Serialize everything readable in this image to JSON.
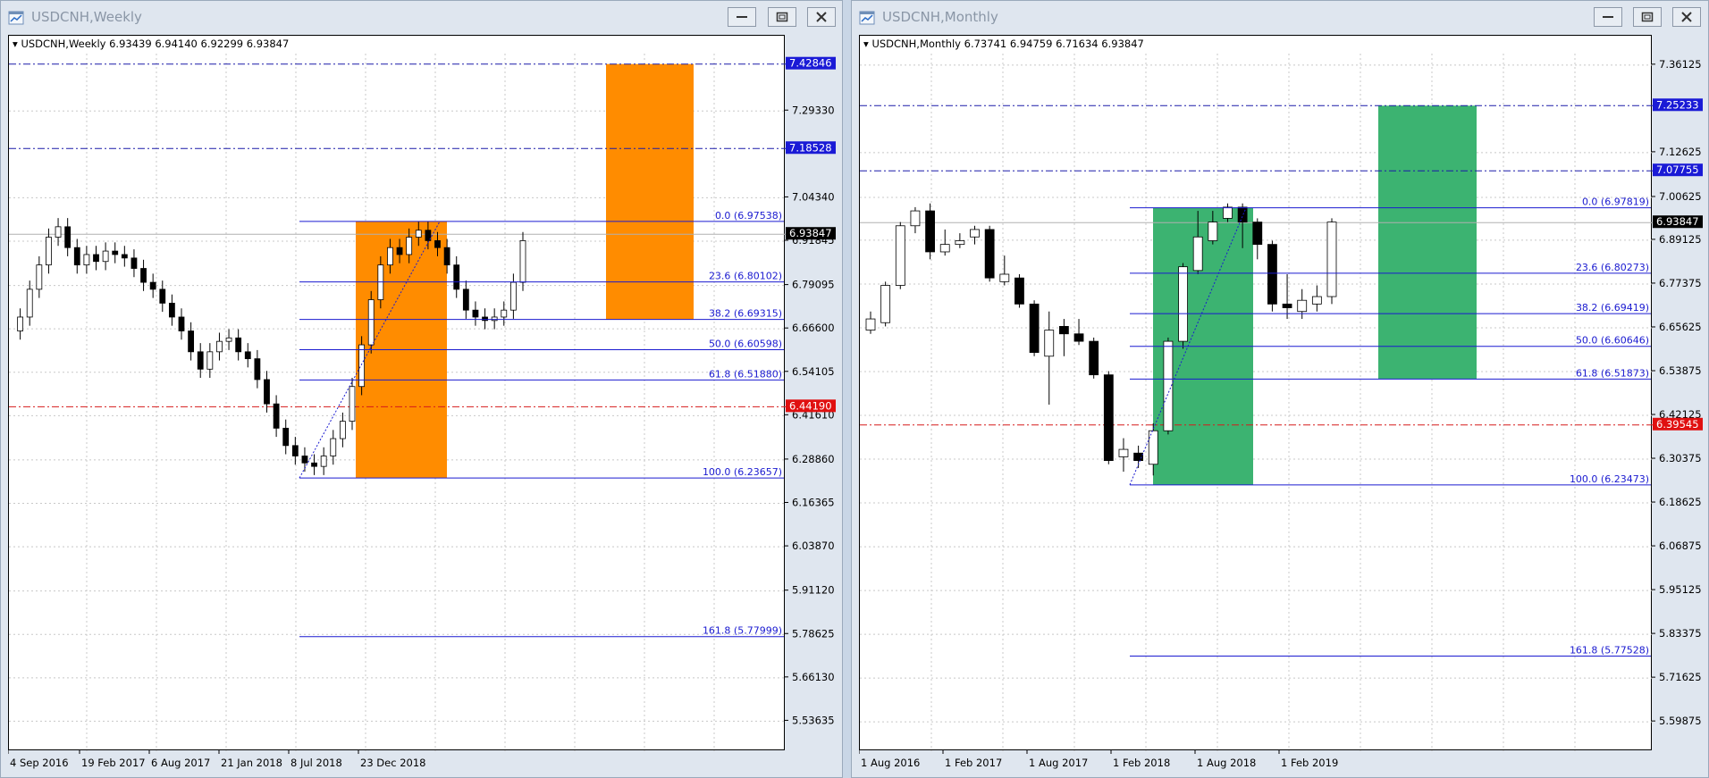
{
  "windows": [
    {
      "id": "weekly",
      "title": "USDCNH,Weekly",
      "info": "USDCNH,Weekly  6.93439 6.94140 6.92299 6.93847",
      "current_price": "6.93847",
      "price_ticks": [
        "7.29330",
        "7.04340",
        "6.91845",
        "6.79095",
        "6.66600",
        "6.54105",
        "6.41610",
        "6.28860",
        "6.16365",
        "6.03870",
        "5.91120",
        "5.78625",
        "5.66130",
        "5.53635"
      ],
      "time_labels": [
        "4 Sep 2016",
        "19 Feb 2017",
        "6 Aug 2017",
        "21 Jan 2018",
        "8 Jul 2018",
        "23 Dec 2018"
      ],
      "hlines": [
        {
          "price": "7.42846",
          "color": "#1a1aa8",
          "style": "dashdot",
          "badge_bg": "#1a1ad6"
        },
        {
          "price": "7.18528",
          "color": "#1a1aa8",
          "style": "dashdot",
          "badge_bg": "#1a1ad6"
        },
        {
          "price": "6.44190",
          "color": "#d61a1a",
          "style": "dashdot",
          "badge_bg": "#e01010"
        }
      ],
      "fib_levels": [
        {
          "label": "0.0 (6.97538)",
          "price": 6.97538
        },
        {
          "label": "23.6 (6.80102)",
          "price": 6.80102
        },
        {
          "label": "38.2 (6.69315)",
          "price": 6.69315
        },
        {
          "label": "50.0 (6.60598)",
          "price": 6.60598
        },
        {
          "label": "61.8 (6.51880)",
          "price": 6.5188
        },
        {
          "label": "100.0 (6.23657)",
          "price": 6.23657
        },
        {
          "label": "161.8 (5.77999)",
          "price": 5.77999
        }
      ],
      "box_color": "#ff8c00"
    },
    {
      "id": "monthly",
      "title": "USDCNH,Monthly",
      "info": "USDCNH,Monthly  6.73741 6.94759 6.71634 6.93847",
      "current_price": "6.93847",
      "price_ticks": [
        "7.36125",
        "7.12625",
        "7.00625",
        "6.89125",
        "6.77375",
        "6.65625",
        "6.53875",
        "6.42125",
        "6.30375",
        "6.18625",
        "6.06875",
        "5.95125",
        "5.83375",
        "5.71625",
        "5.59875"
      ],
      "time_labels": [
        "1 Aug 2016",
        "1 Feb 2017",
        "1 Aug 2017",
        "1 Feb 2018",
        "1 Aug 2018",
        "1 Feb 2019"
      ],
      "hlines": [
        {
          "price": "7.25233",
          "color": "#1a1aa8",
          "style": "dashdot",
          "badge_bg": "#1a1ad6"
        },
        {
          "price": "7.07755",
          "color": "#1a1aa8",
          "style": "dashdot",
          "badge_bg": "#1a1ad6"
        },
        {
          "price": "6.39545",
          "color": "#d61a1a",
          "style": "dashdot",
          "badge_bg": "#e01010"
        }
      ],
      "fib_levels": [
        {
          "label": "0.0 (6.97819)",
          "price": 6.97819
        },
        {
          "label": "23.6 (6.80273)",
          "price": 6.80273
        },
        {
          "label": "38.2 (6.69419)",
          "price": 6.69419
        },
        {
          "label": "50.0 (6.60646)",
          "price": 6.60646
        },
        {
          "label": "61.8 (6.51873)",
          "price": 6.51873
        },
        {
          "label": "100.0 (6.23473)",
          "price": 6.23473
        },
        {
          "label": "161.8 (5.77528)",
          "price": 5.77528
        }
      ],
      "box_color": "#3cb371"
    }
  ],
  "icons": {
    "app": "chart-window-icon",
    "min": "minimize-icon",
    "max": "maximize-icon",
    "close": "close-icon"
  }
}
